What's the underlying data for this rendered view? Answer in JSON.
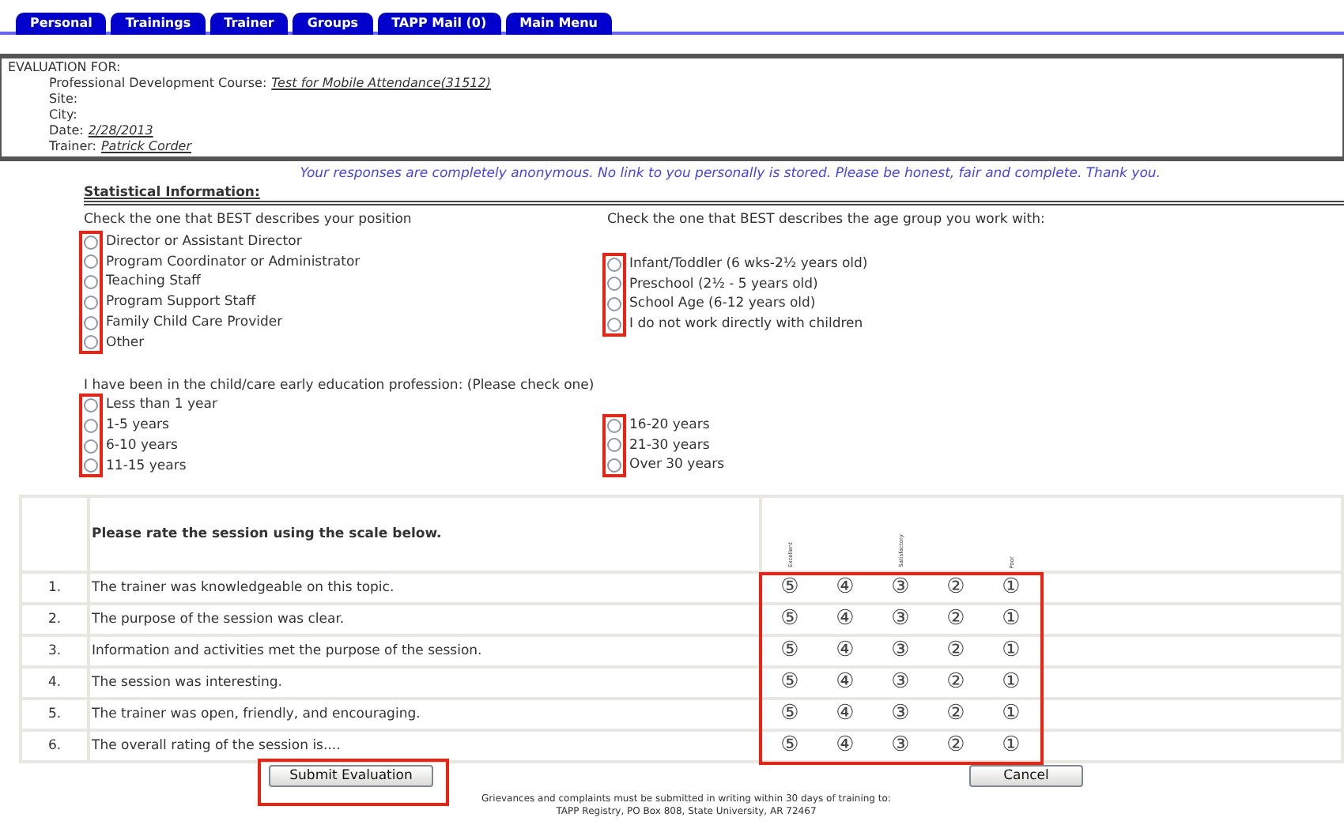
{
  "tabs": [
    {
      "label": "Personal"
    },
    {
      "label": "Trainings"
    },
    {
      "label": "Trainer"
    },
    {
      "label": "Groups"
    },
    {
      "label": "TAPP Mail (0)"
    },
    {
      "label": "Main Menu"
    }
  ],
  "evaluation": {
    "heading": "EVALUATION FOR:",
    "fields": [
      {
        "label": "Professional Development Course:",
        "value": "Test for Mobile Attendance(31512)"
      },
      {
        "label": "Site:"
      },
      {
        "label": "City:"
      },
      {
        "label": "Date:",
        "value": "2/28/2013"
      },
      {
        "label": "Trainer:",
        "value": "Patrick Corder"
      }
    ]
  },
  "notice": "Your responses are completely anonymous. No link to you personally is stored. Please be honest, fair and complete. Thank you.",
  "statistical_heading": "Statistical Information:",
  "position": {
    "prompt": "Check the one that BEST describes your position",
    "highlighted": true,
    "options": [
      {
        "label": "Director or Assistant Director",
        "selected": false
      },
      {
        "label": "Program Coordinator or Administrator",
        "selected": false
      },
      {
        "label": "Teaching Staff",
        "selected": false
      },
      {
        "label": "Program Support Staff",
        "selected": false
      },
      {
        "label": "Family Child Care Provider",
        "selected": false
      },
      {
        "label": "Other",
        "selected": false
      }
    ]
  },
  "age_group": {
    "prompt": "Check the one that BEST describes the age group you work with:",
    "highlighted": true,
    "options": [
      {
        "label": "Infant/Toddler (6 wks-2½ years old)",
        "selected": false
      },
      {
        "label": "Preschool (2½ - 5 years old)",
        "selected": false
      },
      {
        "label": "School Age (6-12 years old)",
        "selected": false
      },
      {
        "label": "I do not work directly with children",
        "selected": false
      }
    ]
  },
  "experience": {
    "prompt": "I have been in the child/care early education profession: (Please check one)",
    "highlighted": true,
    "left_options": [
      {
        "label": "Less than 1 year",
        "selected": false
      },
      {
        "label": "1-5 years",
        "selected": false
      },
      {
        "label": "6-10 years",
        "selected": false
      },
      {
        "label": "11-15 years",
        "selected": false
      }
    ],
    "right_options": [
      {
        "label": "16-20 years",
        "selected": false
      },
      {
        "label": "21-30 years",
        "selected": false
      },
      {
        "label": "Over 30 years",
        "selected": false
      }
    ]
  },
  "rating_table": {
    "heading": "Please rate the session using the scale below.",
    "highlighted": true,
    "scale_labels": {
      "excellent": "Excellent",
      "satisfactory": "Satisfactory",
      "poor": "Poor"
    },
    "rows": [
      {
        "number": "1.",
        "statement": "The trainer was knowledgeable on this topic.",
        "ratings": [
          "⑤",
          "④",
          "③",
          "②",
          "①"
        ]
      },
      {
        "number": "2.",
        "statement": "The purpose of the session was clear.",
        "ratings": [
          "⑤",
          "④",
          "③",
          "②",
          "①"
        ]
      },
      {
        "number": "3.",
        "statement": "Information and activities met the purpose of the session.",
        "ratings": [
          "⑤",
          "④",
          "③",
          "②",
          "①"
        ]
      },
      {
        "number": "4.",
        "statement": "The session was interesting.",
        "ratings": [
          "⑤",
          "④",
          "③",
          "②",
          "①"
        ]
      },
      {
        "number": "5.",
        "statement": "The trainer was open, friendly, and encouraging.",
        "ratings": [
          "⑤",
          "④",
          "③",
          "②",
          "①"
        ]
      },
      {
        "number": "6.",
        "statement": "The overall rating of the session is....",
        "ratings": [
          "⑤",
          "④",
          "③",
          "②",
          "①"
        ]
      }
    ]
  },
  "buttons": [
    {
      "label": "Submit Evaluation",
      "kind": "submit",
      "highlighted": true
    },
    {
      "label": "Cancel",
      "kind": "cancel",
      "highlighted": false
    }
  ],
  "footer": [
    "Grievances and complaints must be submitted in writing within 30 days of training to:",
    "TAPP Registry, PO Box 808, State University, AR 72467"
  ]
}
